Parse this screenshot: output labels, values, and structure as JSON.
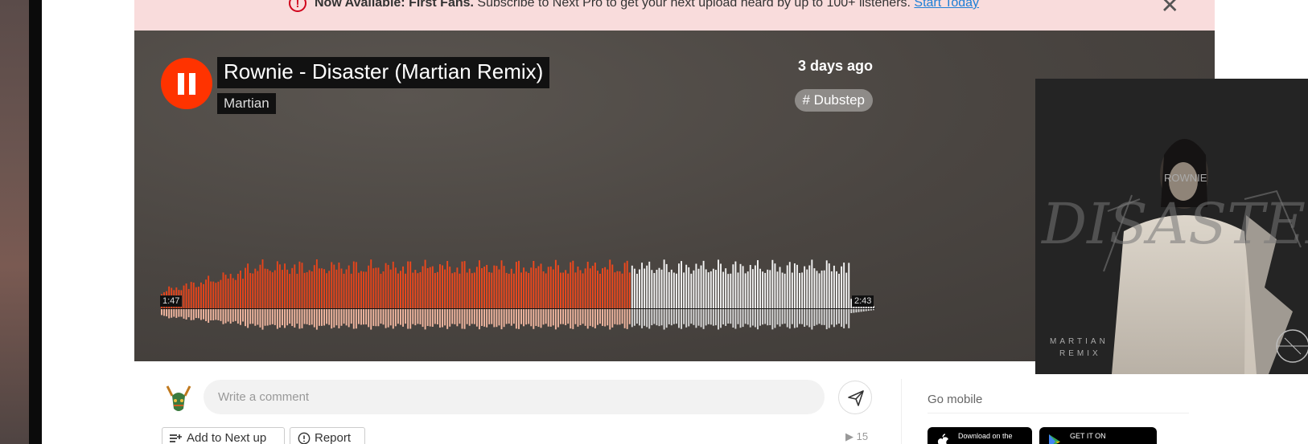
{
  "banner": {
    "bold": "Now Available: First Fans.",
    "text": " Subscribe to Next Pro to get your next upload heard by up to 100+ listeners. ",
    "link": "Start Today"
  },
  "track": {
    "title": "Rownie - Disaster (Martian Remix)",
    "artist": "Martian",
    "posted": "3 days ago",
    "tag": "# Dubstep",
    "current_time": "1:47",
    "duration": "2:43",
    "progress": 0.656
  },
  "artwork": {
    "top_text": "ROWNIE",
    "big_text": "DISASTER",
    "bottom_text_1": "MARTIAN",
    "bottom_text_2": "REMIX"
  },
  "comment": {
    "placeholder": "Write a comment"
  },
  "actions": {
    "add_next": "Add to Next up",
    "report": "Report",
    "plays": "15"
  },
  "sidebar": {
    "go_mobile": "Go mobile",
    "appstore_small": "Download on the",
    "playstore_small": "GET IT ON"
  },
  "colors": {
    "accent": "#ff3300",
    "banner_bg": "#f9dcdc",
    "link": "#1c7ed6"
  }
}
